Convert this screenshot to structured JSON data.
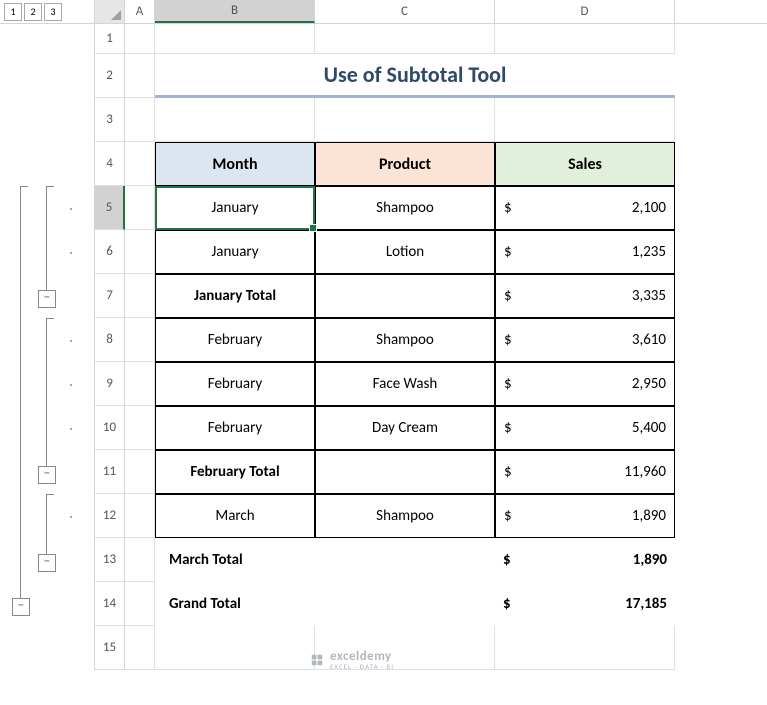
{
  "outline_levels": [
    "1",
    "2",
    "3"
  ],
  "columns": [
    "A",
    "B",
    "C",
    "D"
  ],
  "row_numbers": [
    "1",
    "2",
    "3",
    "4",
    "5",
    "6",
    "7",
    "8",
    "9",
    "10",
    "11",
    "12",
    "13",
    "14",
    "15"
  ],
  "selected_cell": "B5",
  "title": "Use of Subtotal Tool",
  "headers": {
    "month": "Month",
    "product": "Product",
    "sales": "Sales"
  },
  "currency": "$",
  "rows": {
    "r5": {
      "month": "January",
      "product": "Shampoo",
      "sales": "2,100"
    },
    "r6": {
      "month": "January",
      "product": "Lotion",
      "sales": "1,235"
    },
    "r7": {
      "month": "January Total",
      "product": "",
      "sales": "3,335",
      "bold": true
    },
    "r8": {
      "month": "February",
      "product": "Shampoo",
      "sales": "3,610"
    },
    "r9": {
      "month": "February",
      "product": "Face Wash",
      "sales": "2,950"
    },
    "r10": {
      "month": "February",
      "product": "Day Cream",
      "sales": "5,400"
    },
    "r11": {
      "month": "February Total",
      "product": "",
      "sales": "11,960",
      "bold": true
    },
    "r12": {
      "month": "March",
      "product": "Shampoo",
      "sales": "1,890"
    },
    "r13": {
      "month": "March Total",
      "product": "",
      "sales": "1,890",
      "bold": true,
      "noborder": true
    },
    "r14": {
      "month": "Grand Total",
      "product": "",
      "sales": "17,185",
      "bold": true,
      "noborder": true
    }
  },
  "watermark": {
    "name": "exceldemy",
    "tagline": "EXCEL · DATA · BI"
  },
  "chart_data": {
    "type": "table",
    "title": "Use of Subtotal Tool",
    "columns": [
      "Month",
      "Product",
      "Sales"
    ],
    "rows": [
      [
        "January",
        "Shampoo",
        2100
      ],
      [
        "January",
        "Lotion",
        1235
      ],
      [
        "January Total",
        "",
        3335
      ],
      [
        "February",
        "Shampoo",
        3610
      ],
      [
        "February",
        "Face Wash",
        2950
      ],
      [
        "February",
        "Day Cream",
        5400
      ],
      [
        "February Total",
        "",
        11960
      ],
      [
        "March",
        "Shampoo",
        1890
      ],
      [
        "March Total",
        "",
        1890
      ],
      [
        "Grand Total",
        "",
        17185
      ]
    ]
  }
}
